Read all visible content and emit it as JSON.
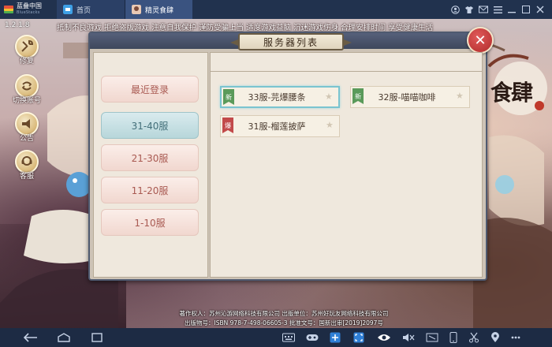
{
  "emulator": {
    "brand_name": "蓝叠中国",
    "brand_sub": "BlueStacks",
    "tabs": [
      {
        "label": "首页"
      },
      {
        "label": "精灵食肆"
      }
    ],
    "toolbar_icons": [
      "account-icon",
      "shirt-icon",
      "mail-icon",
      "menu-icon",
      "minimize-icon",
      "restore-icon",
      "close-icon"
    ]
  },
  "game": {
    "version": "1.2.1.8",
    "notice": "抵制不良游戏 拒绝盗版游戏 注意自我保护 谨防受骗上当 适度游戏益脑 沉迷游戏伤身 合理安排时间 享受健康生活",
    "side_menu": [
      {
        "label": "修复",
        "icon": "repair-icon"
      },
      {
        "label": "切换账号",
        "icon": "switch-account-icon"
      },
      {
        "label": "公告",
        "icon": "announcement-icon"
      },
      {
        "label": "客服",
        "icon": "customer-service-icon"
      }
    ],
    "logo_text": "食肆",
    "license_lines": [
      "著作权人：苏州沁游网络科技有限公司  出版单位：苏州好玩友网络科技有限公司",
      "出版物号：ISBN 978-7-498-06605-3  批准文号：国新出审[2019]2097号"
    ]
  },
  "dialog": {
    "title": "服务器列表",
    "close_label": "✕",
    "tabs": [
      {
        "label": "最近登录",
        "state": "recent"
      },
      {
        "label": "31-40服",
        "state": "active"
      },
      {
        "label": "21-30服",
        "state": "normal"
      },
      {
        "label": "11-20服",
        "state": "normal"
      },
      {
        "label": "1-10服",
        "state": "normal"
      }
    ],
    "servers": [
      {
        "tag": "新",
        "tag_type": "new",
        "name": "33服-芫爆腰条",
        "selected": true
      },
      {
        "tag": "新",
        "tag_type": "new",
        "name": "32服-喵喵咖啡",
        "selected": false
      },
      {
        "tag": "爆",
        "tag_type": "hot",
        "name": "31服-榴莲披萨",
        "selected": false
      }
    ]
  },
  "navbar": {
    "left_icons": [
      "back-icon",
      "home-icon",
      "recent-apps-icon"
    ],
    "right_icons": [
      "keyboard-mapping-icon",
      "gamepad-icon",
      "add-app-icon",
      "fullscreen-icon",
      "eye-icon",
      "volume-icon",
      "resize-icon",
      "phone-icon",
      "scissors-icon",
      "location-icon",
      "more-icon"
    ]
  },
  "colors": {
    "titlebar": "#21324e",
    "active_tab": "#b7d6da",
    "normal_tab_text": "#a95a52",
    "new_tag": "#5a9a5a",
    "hot_tag": "#c24a4a",
    "close_button": "#c03a3a"
  }
}
